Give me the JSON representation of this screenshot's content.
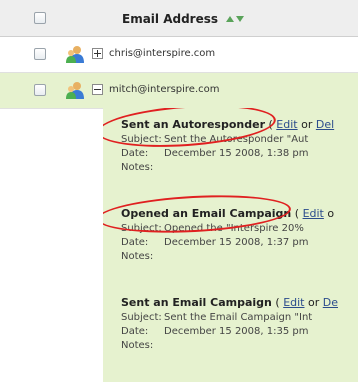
{
  "header": {
    "column_label": "Email Address"
  },
  "rows": [
    {
      "email": "chris@interspire.com",
      "expanded": false
    },
    {
      "email": "mitch@interspire.com",
      "expanded": true
    }
  ],
  "events": [
    {
      "title": "Sent an Autoresponder",
      "open": " ( ",
      "edit": "Edit",
      "or": " or ",
      "delete": "Del",
      "subject_label": "Subject:",
      "subject": "Sent the Autoresponder \"Aut",
      "date_label": "Date:",
      "date": "December 15 2008, 1:38 pm",
      "notes_label": "Notes:"
    },
    {
      "title": "Opened an Email Campaign",
      "open": " ( ",
      "edit": "Edit",
      "or": " o",
      "delete": "",
      "subject_label": "Subject:",
      "subject": "Opened the \"Interspire 20%",
      "date_label": "Date:",
      "date": "December 15 2008, 1:37 pm",
      "notes_label": "Notes:"
    },
    {
      "title": "Sent an Email Campaign",
      "open": " ( ",
      "edit": "Edit",
      "or": " or ",
      "delete": "De",
      "subject_label": "Subject:",
      "subject": "Sent the Email Campaign \"Int",
      "date_label": "Date:",
      "date": "December 15 2008, 1:35 pm",
      "notes_label": "Notes:"
    }
  ],
  "colors": {
    "highlight_row": "#e6f2cf",
    "annotation": "#e02020",
    "link": "#2b4c8c"
  }
}
